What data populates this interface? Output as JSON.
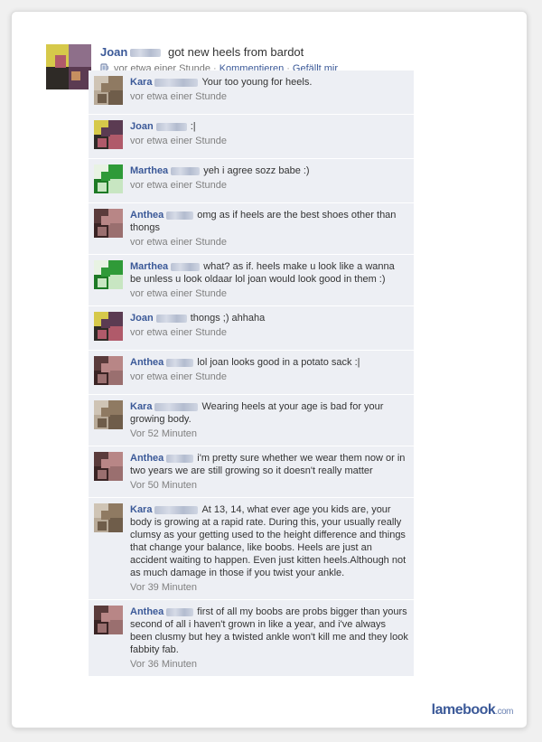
{
  "post": {
    "author": "Joan",
    "text": "got new heels from bardot",
    "time": "vor etwa einer Stunde",
    "comment_link": "Kommentieren",
    "like_link": "Gefällt mir"
  },
  "comments": [
    {
      "name": "Kara",
      "text": "Your too young for heels.",
      "time": "vor etwa einer Stunde",
      "avatar": "kara"
    },
    {
      "name": "Joan",
      "text": ":|",
      "time": "vor etwa einer Stunde",
      "avatar": "joan"
    },
    {
      "name": "Marthea",
      "text": "yeh i agree sozz babe :)",
      "time": "vor etwa einer Stunde",
      "avatar": "marthea"
    },
    {
      "name": "Anthea",
      "text": "omg as if heels are the best shoes other than thongs",
      "time": "vor etwa einer Stunde",
      "avatar": "anthea"
    },
    {
      "name": "Marthea",
      "text": "what? as if. heels make u look like a wanna be unless u look oldaar lol joan would look good in them :)",
      "time": "vor etwa einer Stunde",
      "avatar": "marthea"
    },
    {
      "name": "Joan",
      "text": "thongs ;) ahhaha",
      "time": "vor etwa einer Stunde",
      "avatar": "joan"
    },
    {
      "name": "Anthea",
      "text": "lol joan looks good in a potato sack :|",
      "time": "vor etwa einer Stunde",
      "avatar": "anthea"
    },
    {
      "name": "Kara",
      "text": "Wearing heels at your age is bad for your growing body.",
      "time": "Vor 52 Minuten",
      "avatar": "kara"
    },
    {
      "name": "Anthea",
      "text": "i'm pretty sure whether we wear them now or in two years we are still growing so it doesn't really matter",
      "time": "Vor 50 Minuten",
      "avatar": "anthea"
    },
    {
      "name": "Kara",
      "text": "At 13, 14, what ever age you kids are, your body is growing at a rapid rate. During this, your usually really clumsy as your getting used to the height difference and things that change your balance, like boobs. Heels are just an accident waiting to happen. Even just kitten heels.Although not as much damage in those if you twist your ankle.",
      "time": "Vor 39 Minuten",
      "avatar": "kara"
    },
    {
      "name": "Anthea",
      "text": "first of all my boobs are probs bigger than yours second of all i haven't grown in like a year, and i've always been clusmy but hey a twisted ankle won't kill me and they look fabbity fab.",
      "time": "Vor 36 Minuten",
      "avatar": "anthea"
    }
  ],
  "watermark": {
    "brand": "lamebook",
    "suffix": ".com"
  },
  "avatar_colors": {
    "joan": [
      "#d6c94a",
      "#5b3b52",
      "#2e2a26",
      "#b05a6a"
    ],
    "kara": [
      "#cfc4b5",
      "#8f7a62",
      "#b8aa98",
      "#6f5d4a"
    ],
    "marthea": [
      "#e8f3e3",
      "#2f9a38",
      "#1d7a25",
      "#c8e6c2"
    ],
    "anthea": [
      "#5a3b3b",
      "#b88686",
      "#3a2424",
      "#9a6f6f"
    ]
  }
}
